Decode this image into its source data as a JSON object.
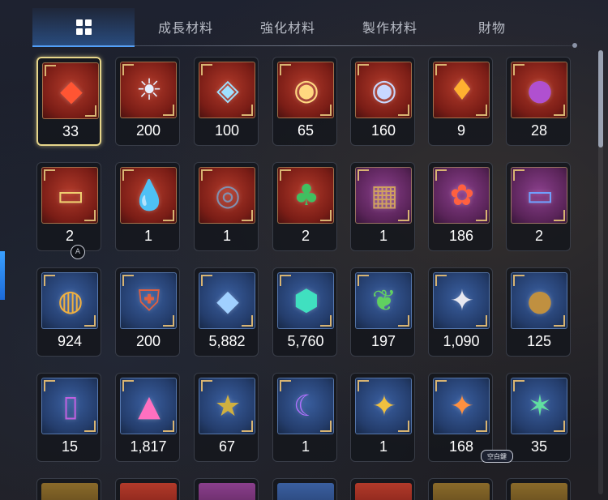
{
  "tabs": [
    {
      "id": "all",
      "label": "",
      "icon": "grid-icon",
      "active": true
    },
    {
      "id": "growth",
      "label": "成長材料",
      "active": false
    },
    {
      "id": "enhance",
      "label": "強化材料",
      "active": false
    },
    {
      "id": "craft",
      "label": "製作材料",
      "active": false
    },
    {
      "id": "treasure",
      "label": "財物",
      "active": false
    }
  ],
  "rows": [
    [
      {
        "qty": "33",
        "icon": "red-crystal-icon",
        "bg": "red",
        "glyph": "◆",
        "color": "#ff5533",
        "selected": true
      },
      {
        "qty": "200",
        "icon": "sun-medallion-icon",
        "bg": "red",
        "glyph": "☀",
        "color": "#e8f0ff"
      },
      {
        "qty": "100",
        "icon": "rainbow-gem-icon",
        "bg": "red",
        "glyph": "◈",
        "color": "#9fe0ff"
      },
      {
        "qty": "65",
        "icon": "eye-emblem-gold-icon",
        "bg": "red",
        "glyph": "◉",
        "color": "#ffd880"
      },
      {
        "qty": "160",
        "icon": "eye-emblem-silver-icon",
        "bg": "red",
        "glyph": "◉",
        "color": "#c8d8ff"
      },
      {
        "qty": "9",
        "icon": "amber-shard-icon",
        "bg": "red",
        "glyph": "♦",
        "color": "#ffb030"
      },
      {
        "qty": "28",
        "icon": "purple-disc-icon",
        "bg": "red",
        "glyph": "●",
        "color": "#b050d0"
      }
    ],
    [
      {
        "qty": "2",
        "icon": "gold-ticket-icon",
        "bg": "red",
        "glyph": "▭",
        "color": "#f0d070"
      },
      {
        "qty": "1",
        "icon": "blue-pendant-icon",
        "bg": "red",
        "glyph": "💧",
        "color": "#40b0e0"
      },
      {
        "qty": "1",
        "icon": "dark-ring-pendant-icon",
        "bg": "red",
        "glyph": "◎",
        "color": "#8090b0"
      },
      {
        "qty": "2",
        "icon": "clover-pendant-icon",
        "bg": "red",
        "glyph": "♣",
        "color": "#40c060"
      },
      {
        "qty": "1",
        "icon": "treasure-map-icon",
        "bg": "purple",
        "glyph": "▦",
        "color": "#d0a060"
      },
      {
        "qty": "186",
        "icon": "flower-ring-icon",
        "bg": "purple",
        "glyph": "✿",
        "color": "#ff6040"
      },
      {
        "qty": "2",
        "icon": "blue-ticket-icon",
        "bg": "purple",
        "glyph": "▭",
        "color": "#70a0ff"
      }
    ],
    [
      {
        "qty": "924",
        "icon": "gold-coins-icon",
        "bg": "blue",
        "glyph": "◍",
        "color": "#f0b040"
      },
      {
        "qty": "200",
        "icon": "heraldic-badge-icon",
        "bg": "blue",
        "glyph": "⛨",
        "color": "#e06040"
      },
      {
        "qty": "5,882",
        "icon": "blue-crystal-icon",
        "bg": "blue",
        "glyph": "◆",
        "color": "#a0d0ff"
      },
      {
        "qty": "5,760",
        "icon": "teal-crystal-icon",
        "bg": "blue",
        "glyph": "⬢",
        "color": "#40e0c0"
      },
      {
        "qty": "197",
        "icon": "green-leaf-icon",
        "bg": "blue",
        "glyph": "❦",
        "color": "#60d060"
      },
      {
        "qty": "1,090",
        "icon": "silver-star-coin-icon",
        "bg": "blue",
        "glyph": "✦",
        "color": "#e8e8f0"
      },
      {
        "qty": "125",
        "icon": "bronze-coin-icon",
        "bg": "blue",
        "glyph": "●",
        "color": "#c09040"
      }
    ],
    [
      {
        "qty": "15",
        "icon": "purple-card-icon",
        "bg": "blue",
        "glyph": "▯",
        "color": "#c060e0"
      },
      {
        "qty": "1,817",
        "icon": "pink-crystal-pile-icon",
        "bg": "blue",
        "glyph": "▲",
        "color": "#ff70c0"
      },
      {
        "qty": "67",
        "icon": "star-medal-icon",
        "bg": "blue",
        "glyph": "★",
        "color": "#d0b040"
      },
      {
        "qty": "1",
        "icon": "moon-pendant-icon",
        "bg": "blue",
        "glyph": "☾",
        "color": "#b070ff"
      },
      {
        "qty": "1",
        "icon": "gold-star-pendant-icon",
        "bg": "blue",
        "glyph": "✦",
        "color": "#f0c040"
      },
      {
        "qty": "168",
        "icon": "orange-star-pendant-icon",
        "bg": "blue",
        "glyph": "✦",
        "color": "#ff9040"
      },
      {
        "qty": "35",
        "icon": "green-star-pendant-icon",
        "bg": "blue",
        "glyph": "✶",
        "color": "#60e0a0"
      }
    ]
  ],
  "partial_row": [
    {
      "icon": "partial-item-1-icon",
      "bg": "gold"
    },
    {
      "icon": "partial-item-2-icon",
      "bg": "red"
    },
    {
      "icon": "partial-item-3-icon",
      "bg": "purple"
    },
    {
      "icon": "partial-item-4-icon",
      "bg": "blue"
    },
    {
      "icon": "partial-item-5-icon",
      "bg": "red"
    },
    {
      "icon": "partial-item-6-icon",
      "bg": "gold"
    },
    {
      "icon": "partial-item-7-icon",
      "bg": "gold"
    }
  ],
  "badges": {
    "a_button": "A",
    "tooltip": "空白鍵"
  }
}
